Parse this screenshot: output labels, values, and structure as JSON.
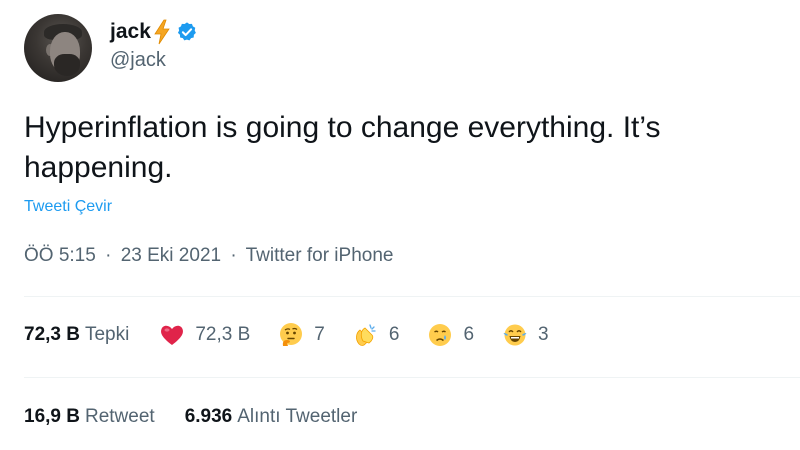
{
  "author": {
    "display_name": "jack",
    "handle": "@jack",
    "badge_icon": "lightning-bolt-icon",
    "verified_icon": "verified-badge-icon",
    "verified_color": "#1d9bf0"
  },
  "tweet": {
    "text": "Hyperinflation is going to change everything. It’s happening.",
    "translate_label": "Tweeti Çevir",
    "time": "ÖÖ 5:15",
    "separator": "·",
    "date": "23 Eki 2021",
    "source": "Twitter for iPhone"
  },
  "reactions_summary": {
    "total": "72,3 B",
    "label": "Tepki",
    "items": [
      {
        "icon": "red-heart-emoji",
        "count": "72,3 B"
      },
      {
        "icon": "thinking-face-emoji",
        "count": "7"
      },
      {
        "icon": "clapping-hands-emoji",
        "count": "6"
      },
      {
        "icon": "crying-face-emoji",
        "count": "6"
      },
      {
        "icon": "tears-of-joy-emoji",
        "count": "3"
      }
    ]
  },
  "engagement": {
    "retweets": {
      "count": "16,9 B",
      "label": "Retweet"
    },
    "quotes": {
      "count": "6.936",
      "label": "Alıntı Tweetler"
    }
  },
  "colors": {
    "accent": "#1d9bf0",
    "secondary_text": "#536471",
    "primary_text": "#0f1419",
    "divider": "#eff3f4"
  }
}
